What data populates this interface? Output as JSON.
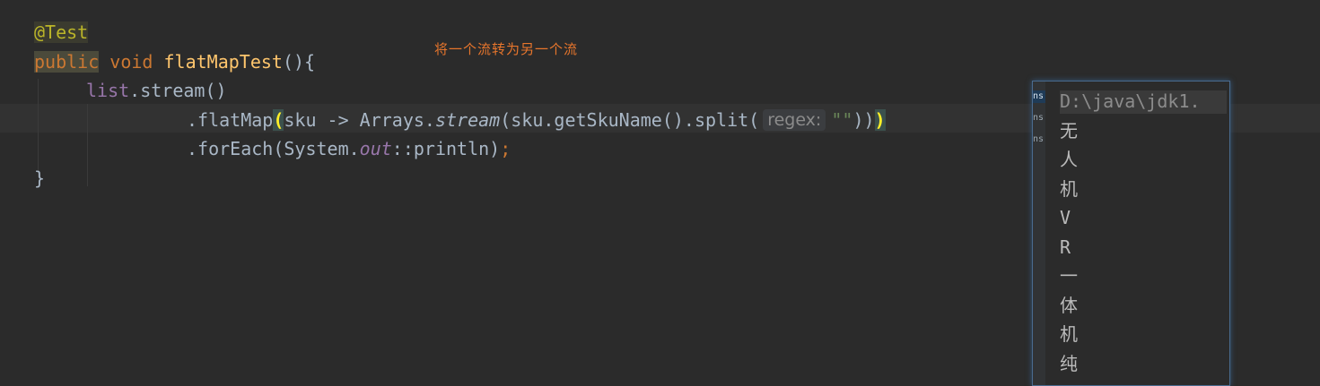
{
  "code": {
    "annotation": "@Test",
    "line2": {
      "kw_public": "public",
      "kw_void": "void",
      "method": "flatMapTest",
      "tail": "(){"
    },
    "line3": {
      "field": "list",
      "tail": ".stream()"
    },
    "line4": {
      "pre": ".flatMap",
      "open": "(",
      "mid1": "sku -> Arrays.",
      "static_call": "stream",
      "mid2": "(sku.getSkuName().split(",
      "hint": "regex:",
      "str": "\"\"",
      "mid3": "))",
      "close": ")"
    },
    "line5": {
      "pre": ".forEach(System.",
      "field": "out",
      "mid": "::println)",
      "semi": ";"
    },
    "line6": "}"
  },
  "comment_note": "将一个流转为另一个流",
  "console": {
    "gutter_tags": [
      "ns",
      "ns",
      "ns"
    ],
    "lines": [
      "D:\\java\\jdk1.",
      "无",
      "人",
      "机",
      "V",
      "R",
      "一",
      "体",
      "机",
      "纯"
    ]
  }
}
